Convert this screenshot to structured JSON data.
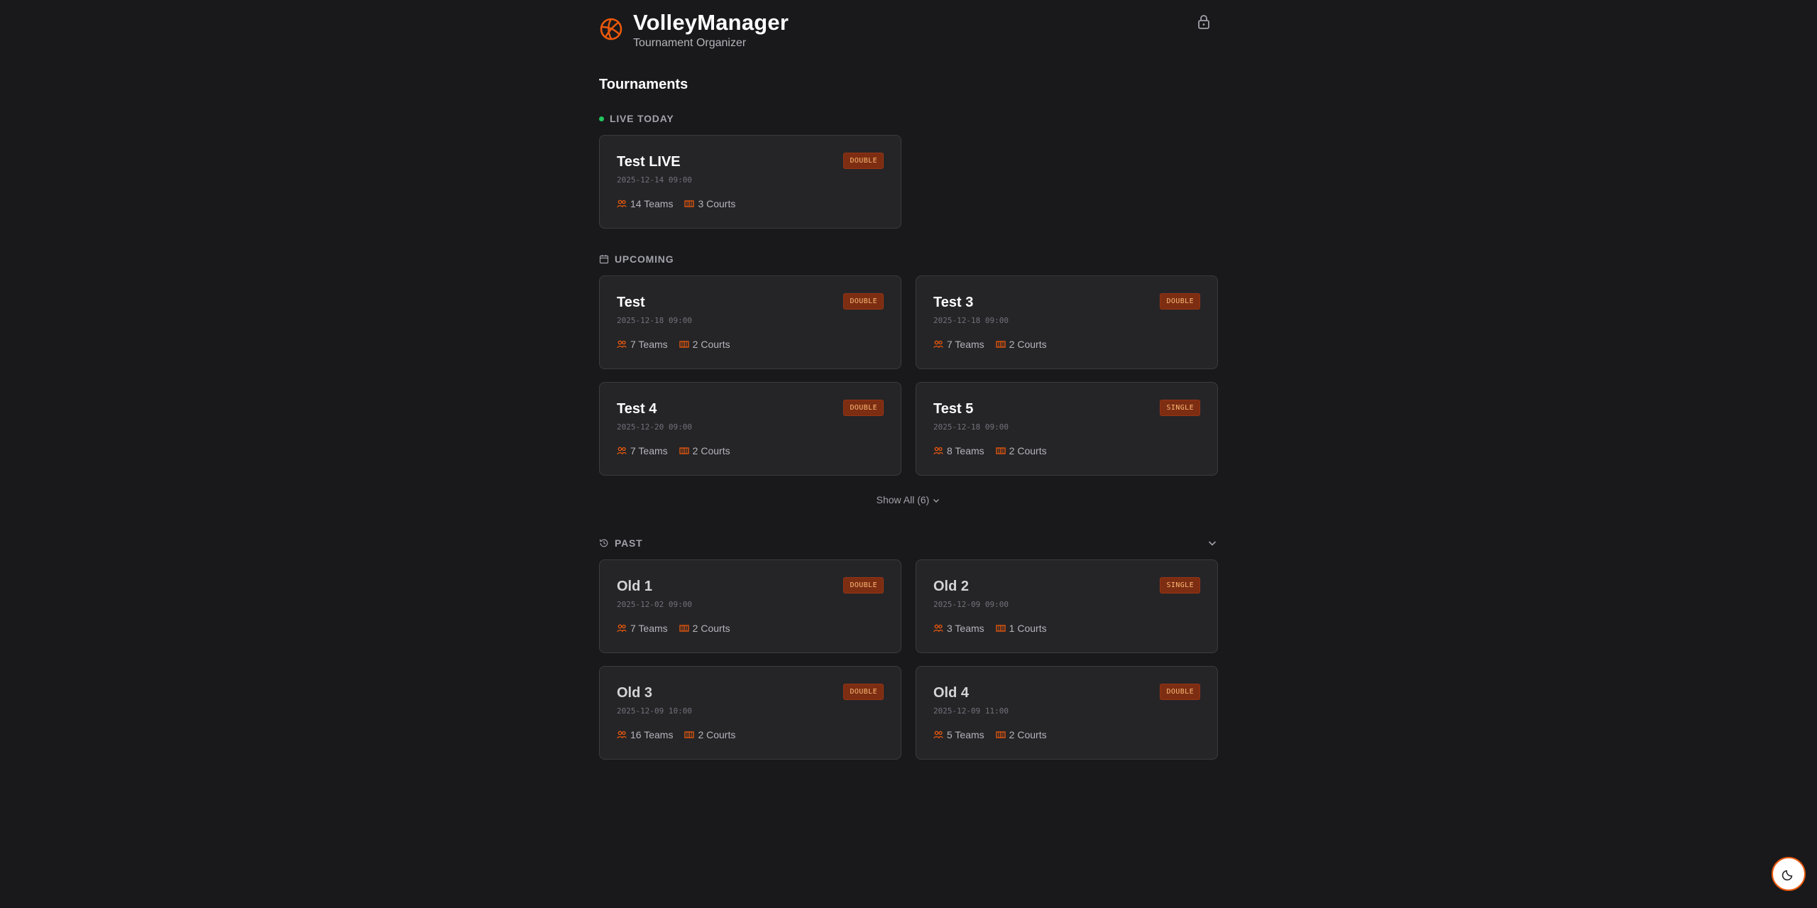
{
  "header": {
    "title": "VolleyManager",
    "subtitle": "Tournament Organizer"
  },
  "page_title": "Tournaments",
  "sections": {
    "live": {
      "label": "LIVE TODAY"
    },
    "upcoming": {
      "label": "UPCOMING"
    },
    "past": {
      "label": "PAST"
    }
  },
  "live_cards": [
    {
      "name": "Test LIVE",
      "date": "2025-12-14 09:00",
      "badge": "DOUBLE",
      "teams": "14 Teams",
      "courts": "3 Courts"
    }
  ],
  "upcoming_cards": [
    {
      "name": "Test",
      "date": "2025-12-18 09:00",
      "badge": "DOUBLE",
      "teams": "7 Teams",
      "courts": "2 Courts"
    },
    {
      "name": "Test 3",
      "date": "2025-12-18 09:00",
      "badge": "DOUBLE",
      "teams": "7 Teams",
      "courts": "2 Courts"
    },
    {
      "name": "Test 4",
      "date": "2025-12-20 09:00",
      "badge": "DOUBLE",
      "teams": "7 Teams",
      "courts": "2 Courts"
    },
    {
      "name": "Test 5",
      "date": "2025-12-18 09:00",
      "badge": "SINGLE",
      "teams": "8 Teams",
      "courts": "2 Courts"
    }
  ],
  "show_all": "Show All (6)",
  "past_cards": [
    {
      "name": "Old 1",
      "date": "2025-12-02 09:00",
      "badge": "DOUBLE",
      "teams": "7 Teams",
      "courts": "2 Courts"
    },
    {
      "name": "Old 2",
      "date": "2025-12-09 09:00",
      "badge": "SINGLE",
      "teams": "3 Teams",
      "courts": "1 Courts"
    },
    {
      "name": "Old 3",
      "date": "2025-12-09 10:00",
      "badge": "DOUBLE",
      "teams": "16 Teams",
      "courts": "2 Courts"
    },
    {
      "name": "Old 4",
      "date": "2025-12-09 11:00",
      "badge": "DOUBLE",
      "teams": "5 Teams",
      "courts": "2 Courts"
    }
  ],
  "icons": {
    "logo": "volleyball-icon",
    "lock": "lock-icon",
    "teams": "users-icon",
    "courts": "court-icon",
    "theme": "moon-icon"
  },
  "colors": {
    "accent": "#ea580c",
    "badge_bg": "#7c2d12",
    "badge_text": "#fdba74",
    "live_dot": "#22c55e"
  }
}
